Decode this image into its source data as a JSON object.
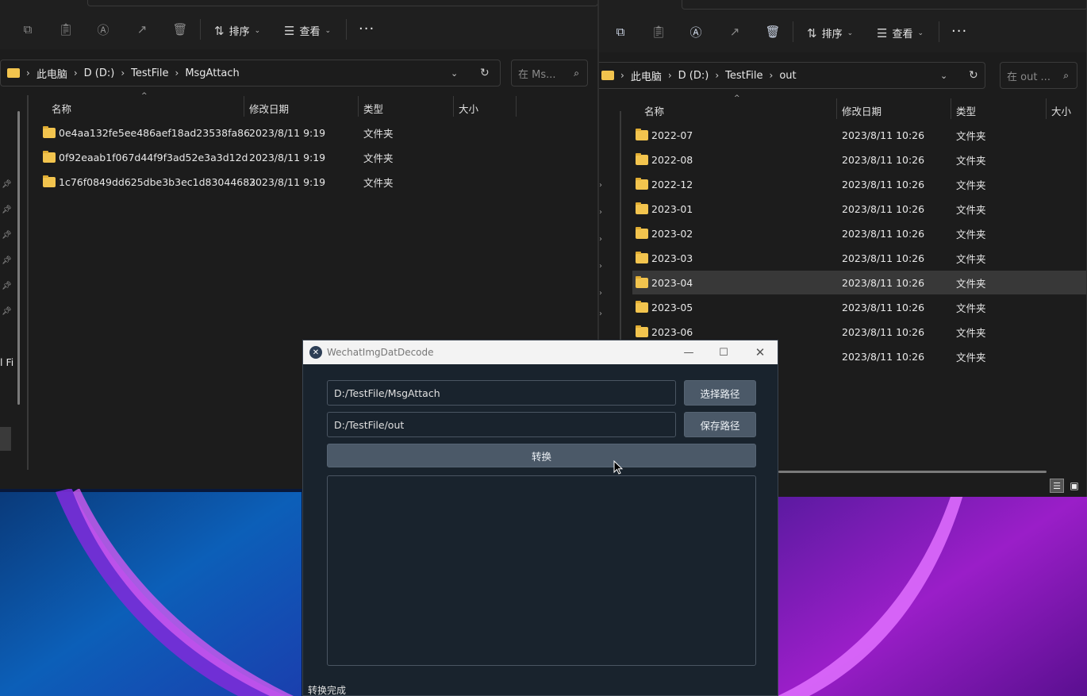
{
  "left_explorer": {
    "toolbar": {
      "sort_label": "排序",
      "view_label": "查看",
      "more_label": "···"
    },
    "breadcrumb": [
      "此电脑",
      "D (D:)",
      "TestFile",
      "MsgAttach"
    ],
    "search_placeholder": "在 Ms...",
    "columns": {
      "name": "名称",
      "modified": "修改日期",
      "type": "类型",
      "size": "大小"
    },
    "rows": [
      {
        "name": "0e4aa132fe5ee486aef18ad23538fa86",
        "modified": "2023/8/11 9:19",
        "type": "文件夹"
      },
      {
        "name": "0f92eaab1f067d44f9f3ad52e3a3d12d",
        "modified": "2023/8/11 9:19",
        "type": "文件夹"
      },
      {
        "name": "1c76f0849dd625dbe3b3ec1d83044683",
        "modified": "2023/8/11 9:19",
        "type": "文件夹"
      }
    ],
    "sidebar_fragment": "l Fi"
  },
  "right_explorer": {
    "toolbar": {
      "sort_label": "排序",
      "view_label": "查看",
      "more_label": "···"
    },
    "breadcrumb": [
      "此电脑",
      "D (D:)",
      "TestFile",
      "out"
    ],
    "search_placeholder": "在 out ...",
    "columns": {
      "name": "名称",
      "modified": "修改日期",
      "type": "类型",
      "size": "大小"
    },
    "rows": [
      {
        "name": "2022-07",
        "modified": "2023/8/11 10:26",
        "type": "文件夹"
      },
      {
        "name": "2022-08",
        "modified": "2023/8/11 10:26",
        "type": "文件夹"
      },
      {
        "name": "2022-12",
        "modified": "2023/8/11 10:26",
        "type": "文件夹"
      },
      {
        "name": "2023-01",
        "modified": "2023/8/11 10:26",
        "type": "文件夹"
      },
      {
        "name": "2023-02",
        "modified": "2023/8/11 10:26",
        "type": "文件夹"
      },
      {
        "name": "2023-03",
        "modified": "2023/8/11 10:26",
        "type": "文件夹"
      },
      {
        "name": "2023-04",
        "modified": "2023/8/11 10:26",
        "type": "文件夹",
        "selected": true
      },
      {
        "name": "2023-05",
        "modified": "2023/8/11 10:26",
        "type": "文件夹"
      },
      {
        "name": "2023-06",
        "modified": "2023/8/11 10:26",
        "type": "文件夹"
      },
      {
        "name": "",
        "modified": "2023/8/11 10:26",
        "type": "文件夹"
      }
    ]
  },
  "app": {
    "title": "WechatImgDatDecode",
    "source_path": "D:/TestFile/MsgAttach",
    "output_path": "D:/TestFile/out",
    "choose_path_label": "选择路径",
    "save_path_label": "保存路径",
    "convert_label": "转换",
    "log_text": "",
    "status": "转换完成"
  },
  "colors": {
    "app_bg": "#19232d",
    "button_bg": "#4b5968",
    "explorer_bg": "#1c1c1c",
    "folder": "#f2c44e"
  }
}
